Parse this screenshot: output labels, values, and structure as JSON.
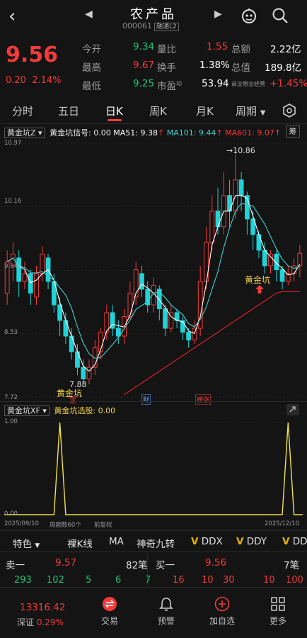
{
  "header": {
    "title": "农产品",
    "code": "000061",
    "tag": "融通L2",
    "back_icon": "‹",
    "prev_icon": "◀",
    "next_icon": "▶"
  },
  "quote": {
    "price": "9.56",
    "change": "0.20",
    "change_pct": "2.14%",
    "rows": [
      {
        "label": "今开",
        "value": "9.34",
        "label2": "量比",
        "value2": "1.55",
        "label3": "总额",
        "value3": "2.22亿"
      },
      {
        "label": "最高",
        "value": "9.67",
        "label2": "换手",
        "value2": "1.38%",
        "label3": "总值",
        "value3": "189.8亿"
      },
      {
        "label": "最低",
        "value": "9.25",
        "label2": "市盈",
        "sup": "动",
        "value2": "53.94",
        "label3": "商业物业经营",
        "value3": "+1.45%"
      }
    ]
  },
  "tabs": [
    "分时",
    "五日",
    "日K",
    "周K",
    "月K",
    "周期"
  ],
  "active_tab": "日K",
  "main_indicator": {
    "name": "黄金坑Z",
    "signal_label": "黄金坑信号: 0.00",
    "ma51": "MA51: 9.38",
    "ma101": "MA101: 9.44",
    "ma601": "MA601: 9.07",
    "chip_btn": "筹",
    "y_top": "10.97",
    "y_mid1": "10.16",
    "y_mid2": "9.34",
    "y_mid3": "8.53",
    "y_bot": "7.72",
    "high_label": "10.86",
    "low_label": "7.88",
    "pit_label1": "黄金坑",
    "pit_label2": "黄金坑",
    "mark_ding": "定",
    "mark_cai": "财",
    "mark_bang": "榜涨"
  },
  "sub_indicator": {
    "name": "黄金坑XF",
    "label": "黄金坑选股: 0.00",
    "y_top": "1.00",
    "y_bot": "0.00",
    "date_start": "2025/09/10",
    "period": "周期数60个",
    "adjust": "前复权",
    "date_end": "2025/12/10"
  },
  "toolbar": [
    "特色",
    "裸K线",
    "MA",
    "神奇九转",
    "DDX",
    "DDY",
    "DD"
  ],
  "orderbook": {
    "sell_label": "卖一",
    "sell_price": "9.57",
    "sell_vol": "82笔",
    "buy_label": "买一",
    "buy_price": "9.56",
    "buy_vol": "7笔",
    "sell_queue": [
      "293",
      "102",
      "5",
      "6",
      "7"
    ],
    "buy_queue": [
      "16",
      "10",
      "30",
      "10",
      "100"
    ]
  },
  "index": {
    "value": "13316.42",
    "name": "深证",
    "pct": "0.29%"
  },
  "nav": [
    "交易",
    "预警",
    "加自选",
    "更多"
  ],
  "chart_data": {
    "type": "candlestick",
    "ylim": [
      7.72,
      10.97
    ],
    "candles": [
      [
        9.05,
        9.45,
        9.6,
        8.9
      ],
      [
        9.4,
        9.55,
        9.7,
        9.2
      ],
      [
        9.5,
        9.2,
        9.6,
        9.0
      ],
      [
        9.2,
        9.3,
        9.45,
        9.1
      ],
      [
        9.3,
        9.05,
        9.35,
        8.9
      ],
      [
        9.0,
        9.3,
        9.4,
        8.9
      ],
      [
        9.3,
        9.55,
        9.65,
        9.2
      ],
      [
        9.5,
        9.2,
        9.55,
        9.1
      ],
      [
        9.2,
        8.9,
        9.3,
        8.8
      ],
      [
        8.9,
        8.7,
        9.0,
        8.5
      ],
      [
        8.7,
        8.5,
        8.8,
        8.4
      ],
      [
        8.5,
        8.3,
        8.6,
        8.2
      ],
      [
        8.3,
        8.1,
        8.4,
        8.0
      ],
      [
        8.1,
        7.95,
        8.2,
        7.88
      ],
      [
        7.95,
        8.1,
        8.2,
        7.88
      ],
      [
        8.1,
        8.35,
        8.45,
        8.0
      ],
      [
        8.3,
        8.55,
        8.6,
        8.2
      ],
      [
        8.55,
        8.8,
        8.9,
        8.45
      ],
      [
        8.8,
        8.6,
        8.9,
        8.5
      ],
      [
        8.6,
        8.5,
        8.7,
        8.4
      ],
      [
        8.5,
        8.75,
        8.85,
        8.4
      ],
      [
        8.75,
        9.05,
        9.2,
        8.7
      ],
      [
        9.0,
        9.35,
        9.45,
        8.9
      ],
      [
        9.3,
        9.1,
        9.4,
        9.0
      ],
      [
        9.1,
        8.9,
        9.2,
        8.8
      ],
      [
        8.9,
        9.15,
        9.25,
        8.8
      ],
      [
        9.1,
        8.85,
        9.15,
        8.7
      ],
      [
        8.85,
        8.6,
        8.9,
        8.5
      ],
      [
        8.6,
        8.8,
        8.9,
        8.55
      ],
      [
        8.8,
        8.7,
        8.85,
        8.6
      ],
      [
        8.7,
        8.55,
        8.75,
        8.45
      ],
      [
        8.55,
        8.45,
        8.6,
        8.35
      ],
      [
        8.45,
        8.6,
        8.7,
        8.4
      ],
      [
        8.6,
        9.2,
        9.4,
        8.5
      ],
      [
        9.2,
        9.7,
        9.9,
        9.1
      ],
      [
        9.7,
        10.1,
        10.3,
        9.6
      ],
      [
        10.1,
        9.9,
        10.4,
        9.8
      ],
      [
        9.9,
        10.3,
        10.6,
        9.8
      ],
      [
        10.3,
        10.1,
        10.5,
        9.9
      ],
      [
        10.1,
        10.5,
        10.86,
        10.0
      ],
      [
        10.5,
        10.3,
        10.6,
        10.1
      ],
      [
        10.3,
        10.0,
        10.35,
        9.8
      ],
      [
        10.0,
        9.8,
        10.1,
        9.6
      ],
      [
        9.8,
        9.6,
        9.85,
        9.5
      ],
      [
        9.6,
        9.4,
        9.7,
        9.3
      ],
      [
        9.4,
        9.55,
        9.6,
        9.3
      ],
      [
        9.55,
        9.35,
        9.6,
        9.2
      ],
      [
        9.35,
        9.2,
        9.4,
        9.1
      ],
      [
        9.2,
        9.3,
        9.4,
        9.15
      ],
      [
        9.3,
        9.4,
        9.5,
        9.2
      ],
      [
        9.4,
        9.56,
        9.67,
        9.25
      ]
    ],
    "signal": {
      "x": [
        0,
        60
      ],
      "peaks": [
        9,
        48
      ]
    }
  }
}
